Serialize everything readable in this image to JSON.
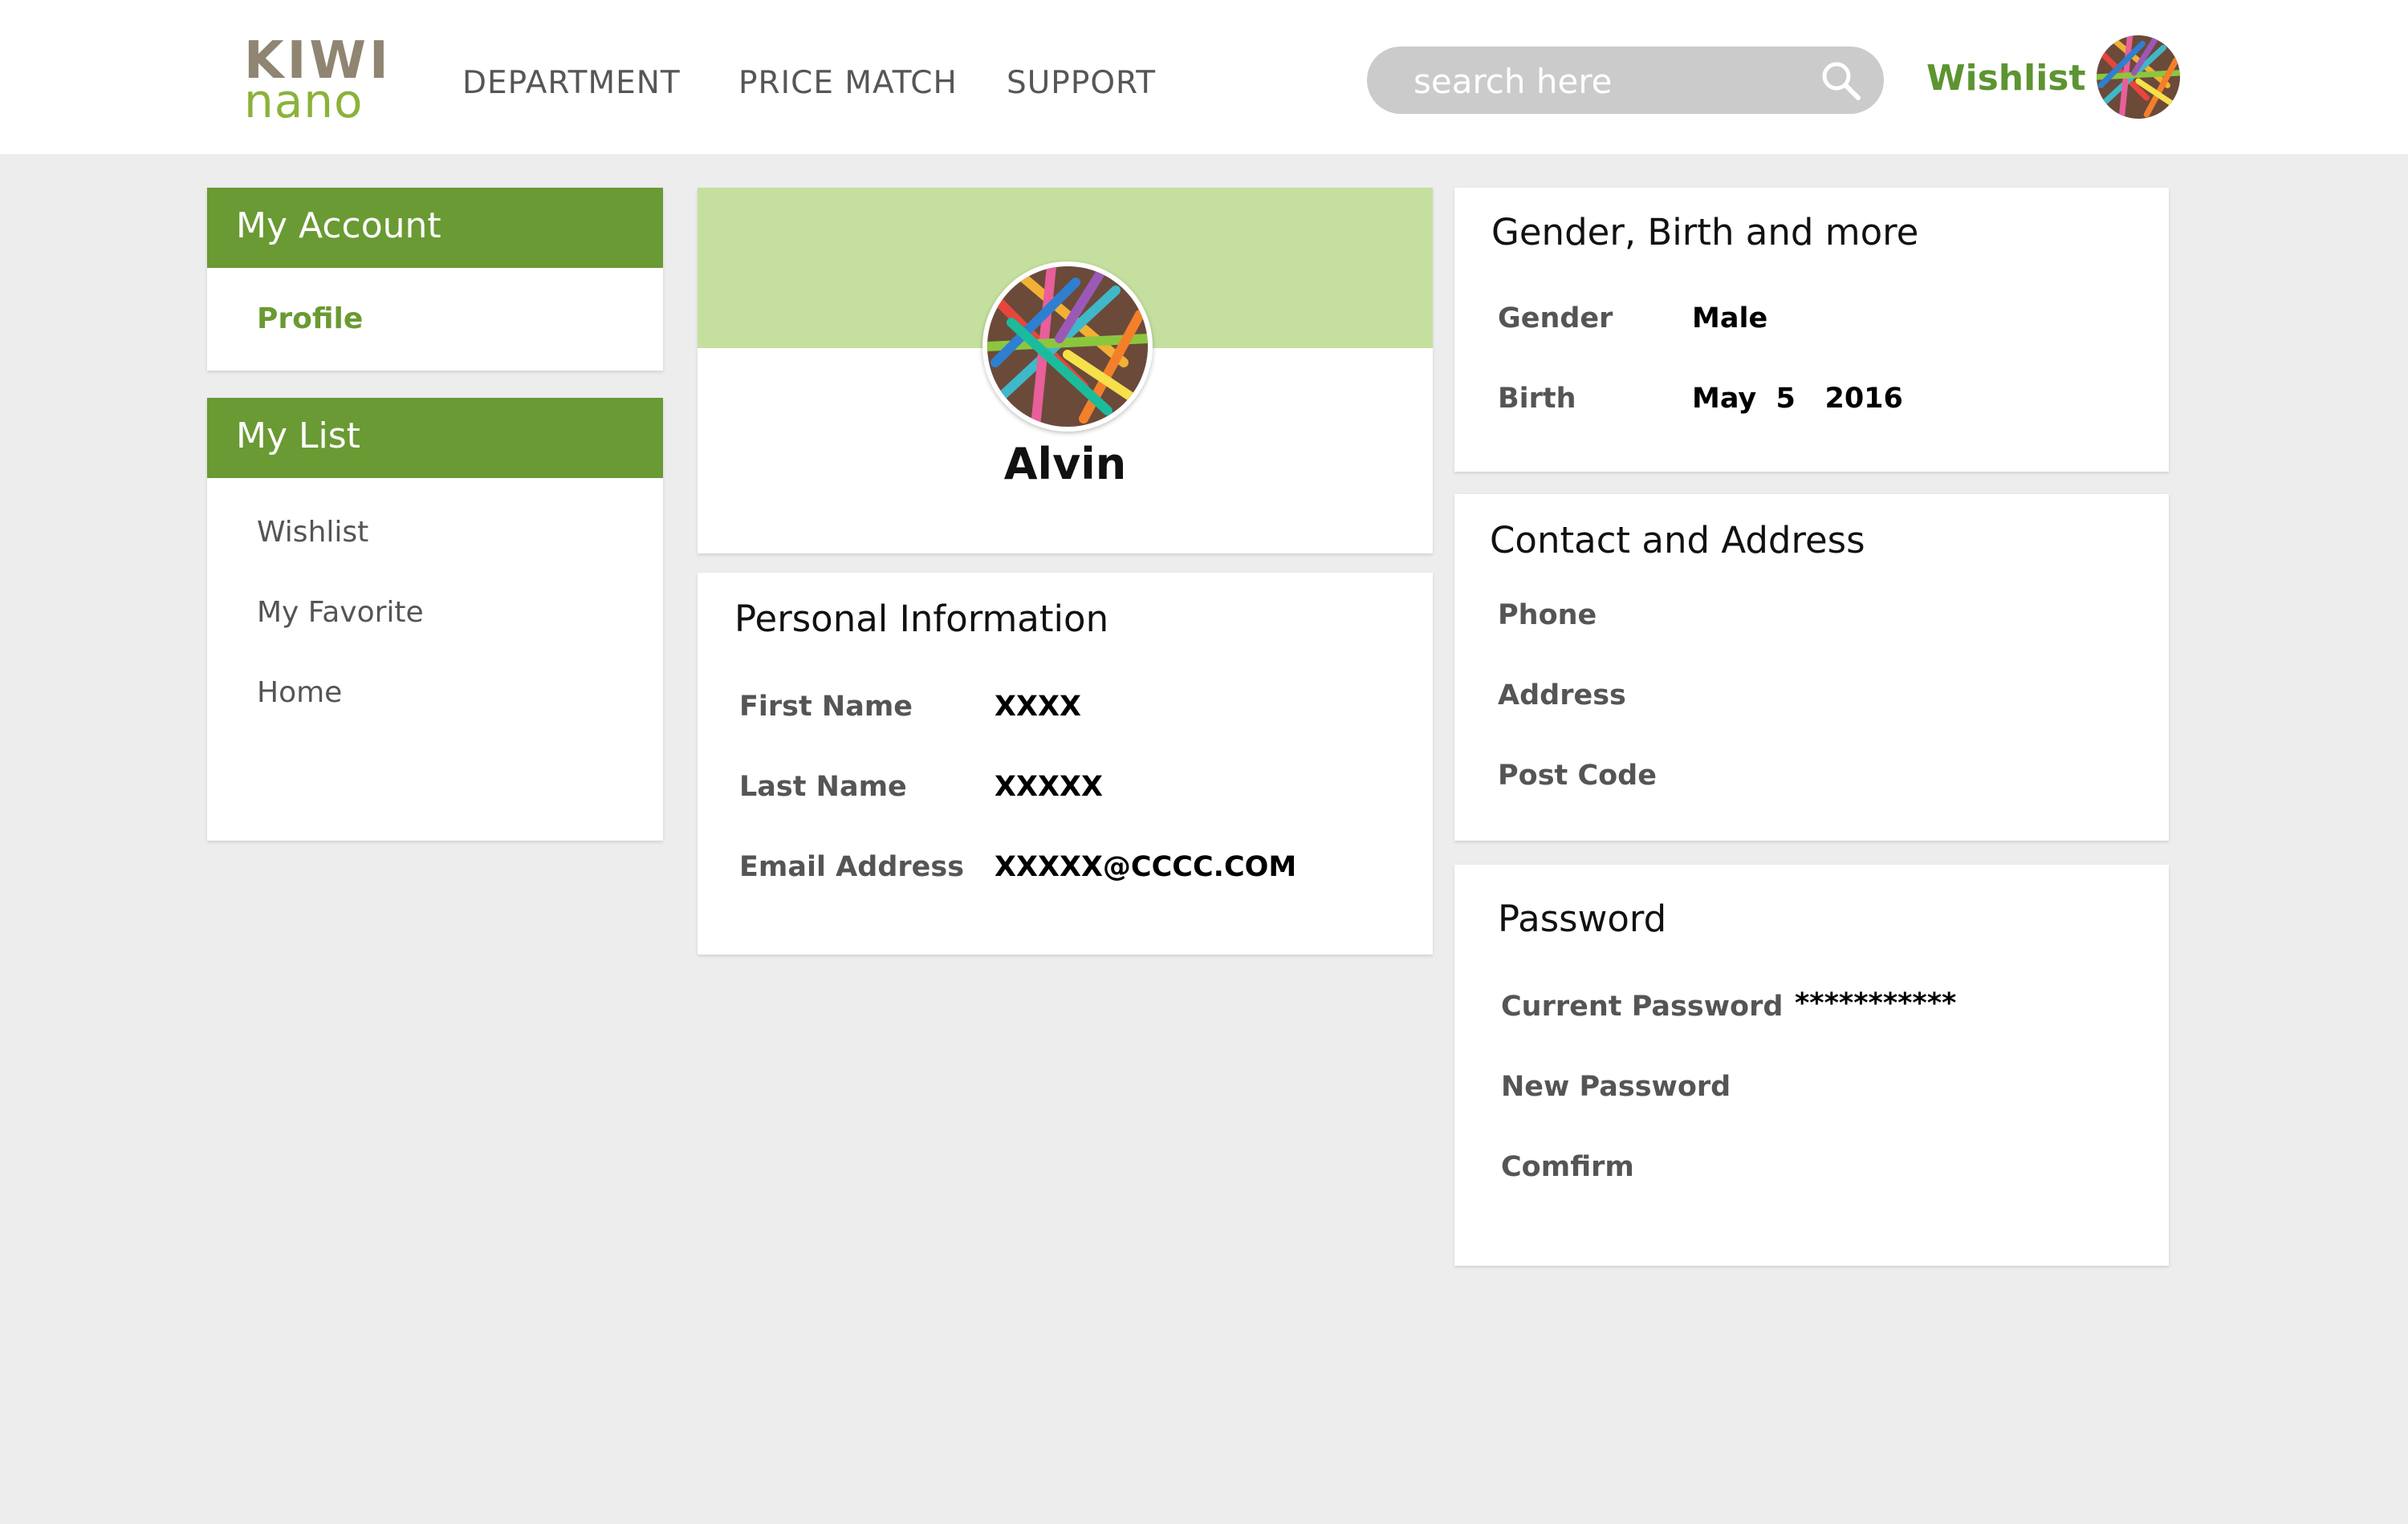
{
  "header": {
    "logo_top": "KIWI",
    "logo_bottom": "nano",
    "nav": [
      "DEPARTMENT",
      "PRICE MATCH",
      "SUPPORT"
    ],
    "search_placeholder": "search here",
    "wishlist_label": "Wishlist"
  },
  "sidebar": {
    "account": {
      "title": "My Account",
      "items": [
        "Profile"
      ]
    },
    "list": {
      "title": "My List",
      "items": [
        "Wishlist",
        "My Favorite",
        "Home"
      ]
    }
  },
  "profile": {
    "name": "Alvin"
  },
  "personal": {
    "title": "Personal Information",
    "fields": [
      {
        "label": "First Name",
        "value": "XXXX"
      },
      {
        "label": "Last Name",
        "value": "XXXXX"
      },
      {
        "label": "Email Address",
        "value": "XXXXX@CCCC.COM"
      }
    ]
  },
  "gender_birth": {
    "title": "Gender, Birth and more",
    "fields": [
      {
        "label": "Gender",
        "value": "Male"
      },
      {
        "label": "Birth",
        "value": "May  5   2016"
      }
    ]
  },
  "contact": {
    "title": "Contact and Address",
    "fields": [
      {
        "label": "Phone",
        "value": ""
      },
      {
        "label": "Address",
        "value": ""
      },
      {
        "label": "Post Code",
        "value": ""
      }
    ]
  },
  "password": {
    "title": "Password",
    "fields": [
      {
        "label": "Current Password",
        "value": "***********"
      },
      {
        "label": "New Password",
        "value": ""
      },
      {
        "label": "Comfirm",
        "value": ""
      }
    ]
  },
  "colors": {
    "brand_green": "#6a9a33",
    "cover_green": "#c5e09e",
    "logo_brown": "#8f8572",
    "logo_green": "#8cb23a",
    "background": "#ededed"
  },
  "icons": {
    "search": "search-icon",
    "avatar": "avatar-image"
  }
}
